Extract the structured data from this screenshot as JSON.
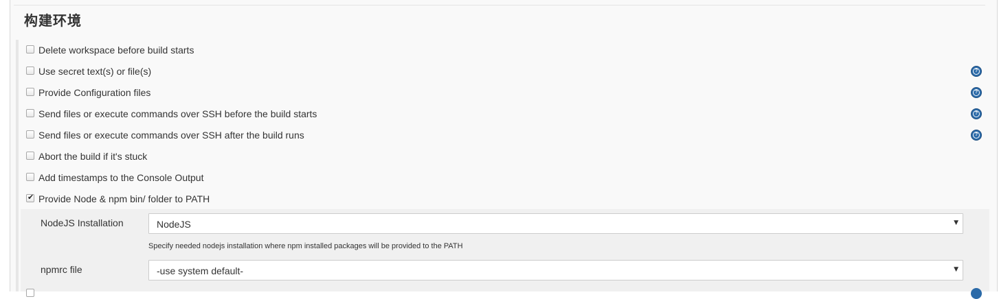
{
  "section": {
    "title": "构建环境"
  },
  "options": [
    {
      "label": "Delete workspace before build starts",
      "checked": false,
      "help": false
    },
    {
      "label": "Use secret text(s) or file(s)",
      "checked": false,
      "help": true
    },
    {
      "label": "Provide Configuration files",
      "checked": false,
      "help": true
    },
    {
      "label": "Send files or execute commands over SSH before the build starts",
      "checked": false,
      "help": true
    },
    {
      "label": "Send files or execute commands over SSH after the build runs",
      "checked": false,
      "help": true
    },
    {
      "label": "Abort the build if it's stuck",
      "checked": false,
      "help": false
    },
    {
      "label": "Add timestamps to the Console Output",
      "checked": false,
      "help": false
    },
    {
      "label": "Provide Node & npm bin/ folder to PATH",
      "checked": true,
      "help": false
    }
  ],
  "node_settings": {
    "installation": {
      "label": "NodeJS Installation",
      "value": "NodeJS",
      "description": "Specify needed nodejs installation where npm installed packages will be provided to the PATH"
    },
    "npmrc": {
      "label": "npmrc file",
      "value": "-use system default-"
    }
  },
  "icons": {
    "help": "help-circle-icon",
    "checkmark": "checkmark-icon",
    "dropdown": "dropdown-arrow-icon"
  },
  "colors": {
    "help_icon": "#2b6aa8",
    "panel_bg": "#f9f9f9",
    "nested_bg": "#f0f0f0"
  }
}
